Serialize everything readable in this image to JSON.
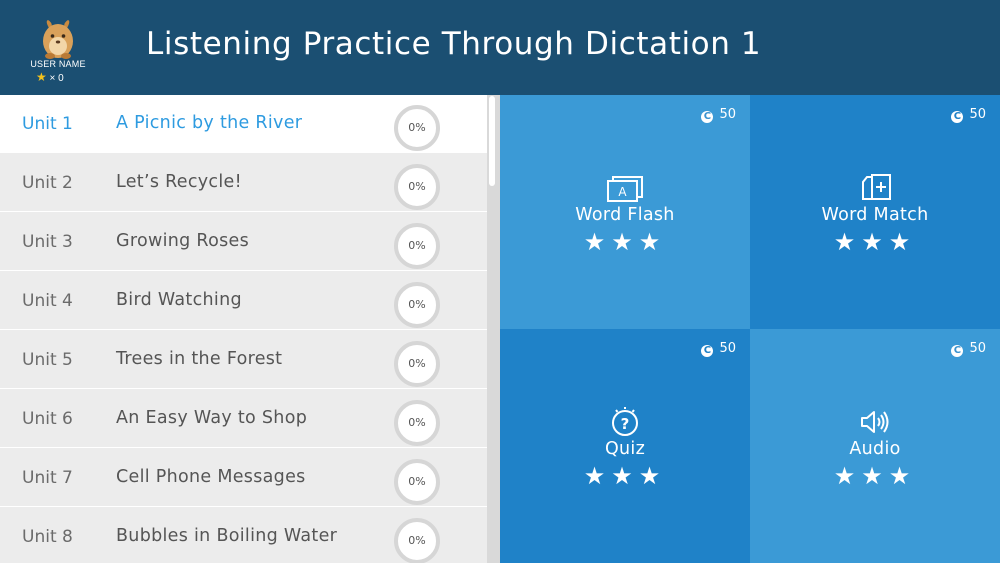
{
  "header": {
    "title": "Listening Practice Through Dictation 1",
    "user_name": "USER NAME",
    "star_count": "× 0",
    "background": "#1b4f72"
  },
  "units": [
    {
      "unit": "Unit 1",
      "title": "A Picnic by the River",
      "progress": "0%",
      "active": true
    },
    {
      "unit": "Unit 2",
      "title": "Let’s Recycle!",
      "progress": "0%"
    },
    {
      "unit": "Unit 3",
      "title": "Growing Roses",
      "progress": "0%"
    },
    {
      "unit": "Unit 4",
      "title": "Bird Watching",
      "progress": "0%"
    },
    {
      "unit": "Unit 5",
      "title": "Trees in the Forest",
      "progress": "0%"
    },
    {
      "unit": "Unit 6",
      "title": "An Easy Way to Shop",
      "progress": "0%"
    },
    {
      "unit": "Unit 7",
      "title": "Cell Phone Messages",
      "progress": "0%"
    },
    {
      "unit": "Unit 8",
      "title": "Bubbles in Boiling Water",
      "progress": "0%"
    }
  ],
  "activities": [
    {
      "label": "Word Flash",
      "points": "50",
      "icon": "word-flash-icon",
      "color": "#3b9ad6"
    },
    {
      "label": "Word Match",
      "points": "50",
      "icon": "word-match-icon",
      "color": "#1f82c8"
    },
    {
      "label": "Quiz",
      "points": "50",
      "icon": "quiz-icon",
      "color": "#1f82c8"
    },
    {
      "label": "Audio",
      "points": "50",
      "icon": "audio-icon",
      "color": "#3b9ad6"
    }
  ],
  "colors": {
    "accent": "#2e9be0",
    "list_bg": "#ececec",
    "star": "#f4c21c"
  }
}
